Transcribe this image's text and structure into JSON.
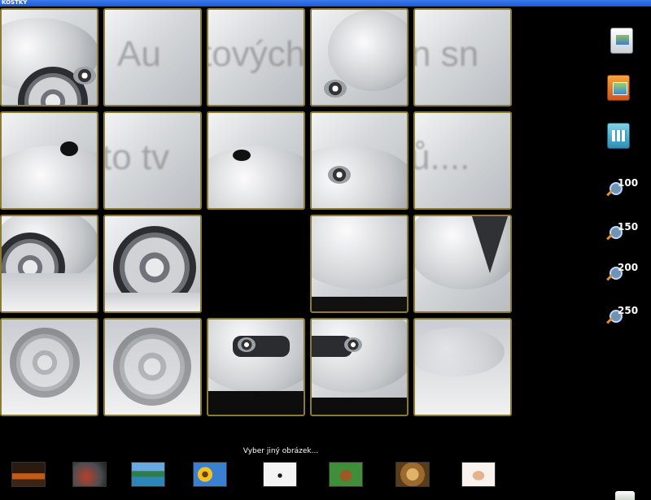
{
  "window": {
    "title": "KOSTKY"
  },
  "puzzle": {
    "watermark_row1": "Autových snů",
    "watermark_row2": "to tvých snů...."
  },
  "sidebar": {
    "icons": [
      "image-load-icon",
      "image-folder-icon",
      "image-grid-icon"
    ],
    "zoom_levels": [
      "100",
      "150",
      "200",
      "250"
    ]
  },
  "footer": {
    "caption": "Vyber jiný obrázek...",
    "thumbnails": [
      "sports-car",
      "motorbike",
      "lake-landscape",
      "sunflowers",
      "dalmatians",
      "beagle-puppy",
      "lion",
      "woman"
    ]
  }
}
